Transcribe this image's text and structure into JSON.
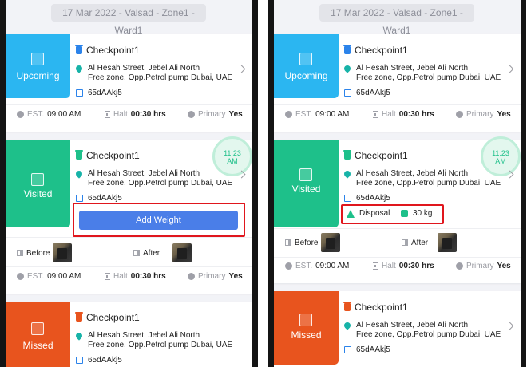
{
  "header": {
    "date_route": "17 Mar 2022 - Valsad - Zone1 -Ward1"
  },
  "checkpoint": {
    "title": "Checkpoint1",
    "address_line1": "Al Hesah Street, Jebel Ali North",
    "address_line2": "Free zone,  Opp.Petrol pump Dubai, UAE",
    "code": "65dAAkj5"
  },
  "meta": {
    "est_label": "EST.",
    "est_time": "09:00 AM",
    "halt_label": "Halt",
    "halt_value": "00:30 hrs",
    "type_label": "Primary",
    "type_value": "Yes"
  },
  "status": {
    "upcoming": "Upcoming",
    "visited": "Visited",
    "missed": "Missed"
  },
  "timer": {
    "time": "11:23",
    "ampm": "AM"
  },
  "actions": {
    "add_weight": "Add Weight"
  },
  "photos": {
    "before": "Before",
    "after": "After"
  },
  "disposal": {
    "label": "Disposal",
    "weight": "30 kg"
  },
  "colors": {
    "upcoming": "#2bb6f1",
    "visited": "#1ec08a",
    "missed": "#e8541e",
    "button": "#4a7ee8",
    "highlight": "#e0161d"
  },
  "icons": [
    "arrow-right-icon",
    "check-icon",
    "close-icon",
    "bin-icon",
    "location-pin-icon",
    "qr-icon",
    "clock-icon",
    "hourglass-icon",
    "info-icon",
    "chevron-right-icon",
    "tree-icon",
    "weight-icon",
    "before-icon",
    "after-icon"
  ]
}
